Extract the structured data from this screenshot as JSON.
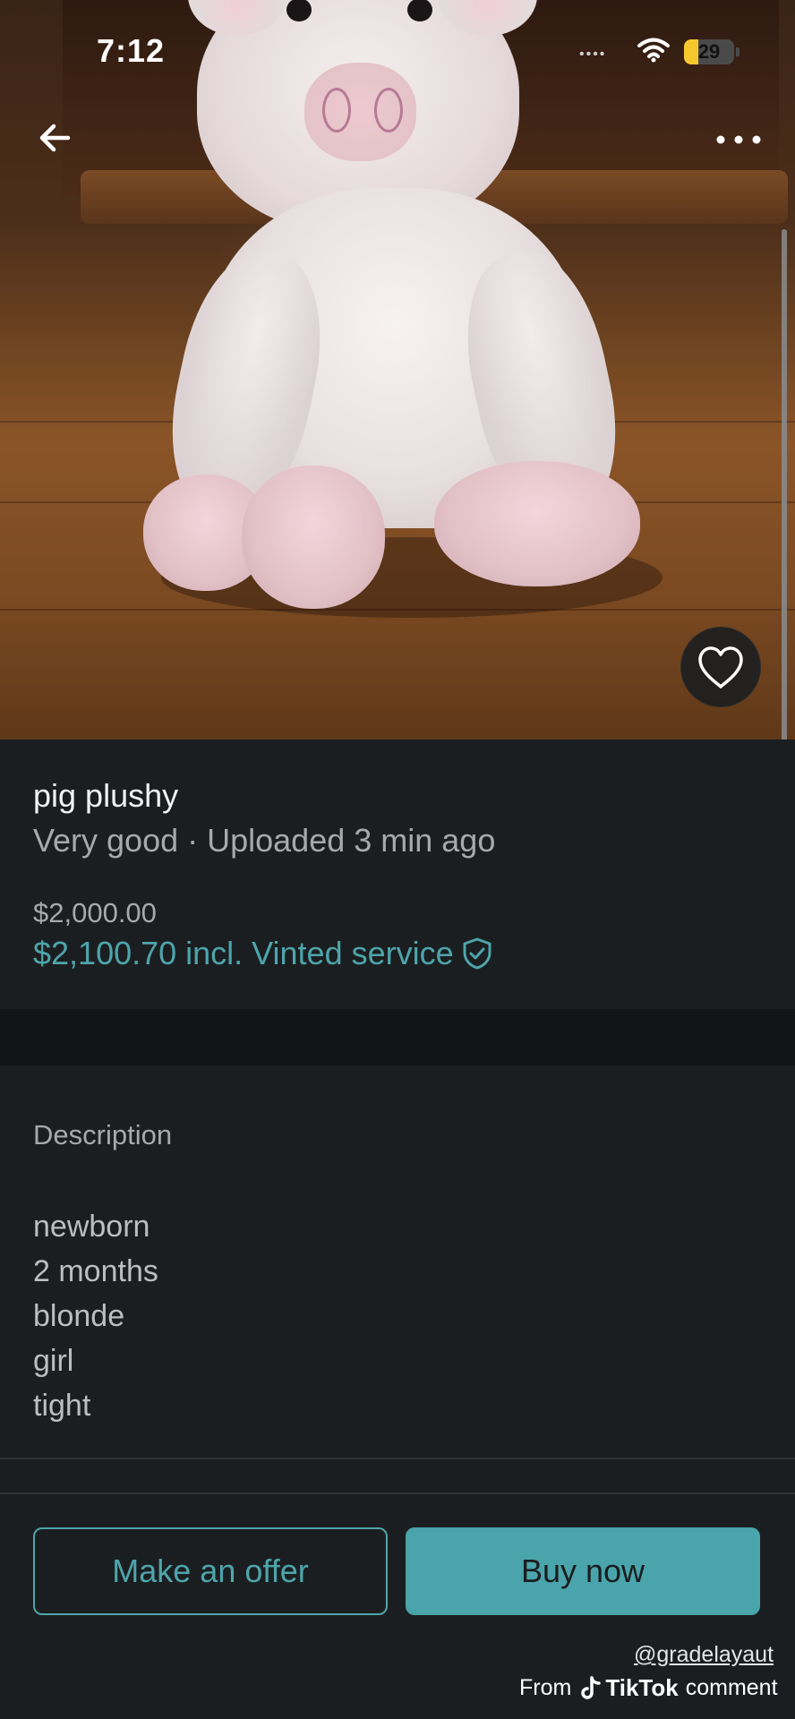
{
  "status_bar": {
    "time": "7:12",
    "signal_dots": "••••",
    "battery": {
      "level_percent": 29,
      "label": "29"
    }
  },
  "icons": {
    "back": "arrow-left-icon",
    "more": "more-horizontal-icon",
    "favorite": "heart-icon",
    "wifi": "wifi-icon",
    "protection": "shield-check-icon",
    "tiktok": "tiktok-icon"
  },
  "item": {
    "title": "pig plushy",
    "meta": "Very good · Uploaded 3 min ago",
    "price": "$2,000.00",
    "total_price": "$2,100.70 incl. Vinted service"
  },
  "description": {
    "heading": "Description",
    "lines": [
      "newborn",
      "2 months",
      "blonde",
      "girl",
      "tight"
    ]
  },
  "actions": {
    "offer_label": "Make an offer",
    "buy_label": "Buy now"
  },
  "watermark": {
    "user": "@gradelayaut",
    "from": "From",
    "brand": "TikTok",
    "suffix": "comment"
  },
  "colors": {
    "accent": "#4aa4ab",
    "background": "#1b1e20",
    "battery": "#f6c72c"
  }
}
